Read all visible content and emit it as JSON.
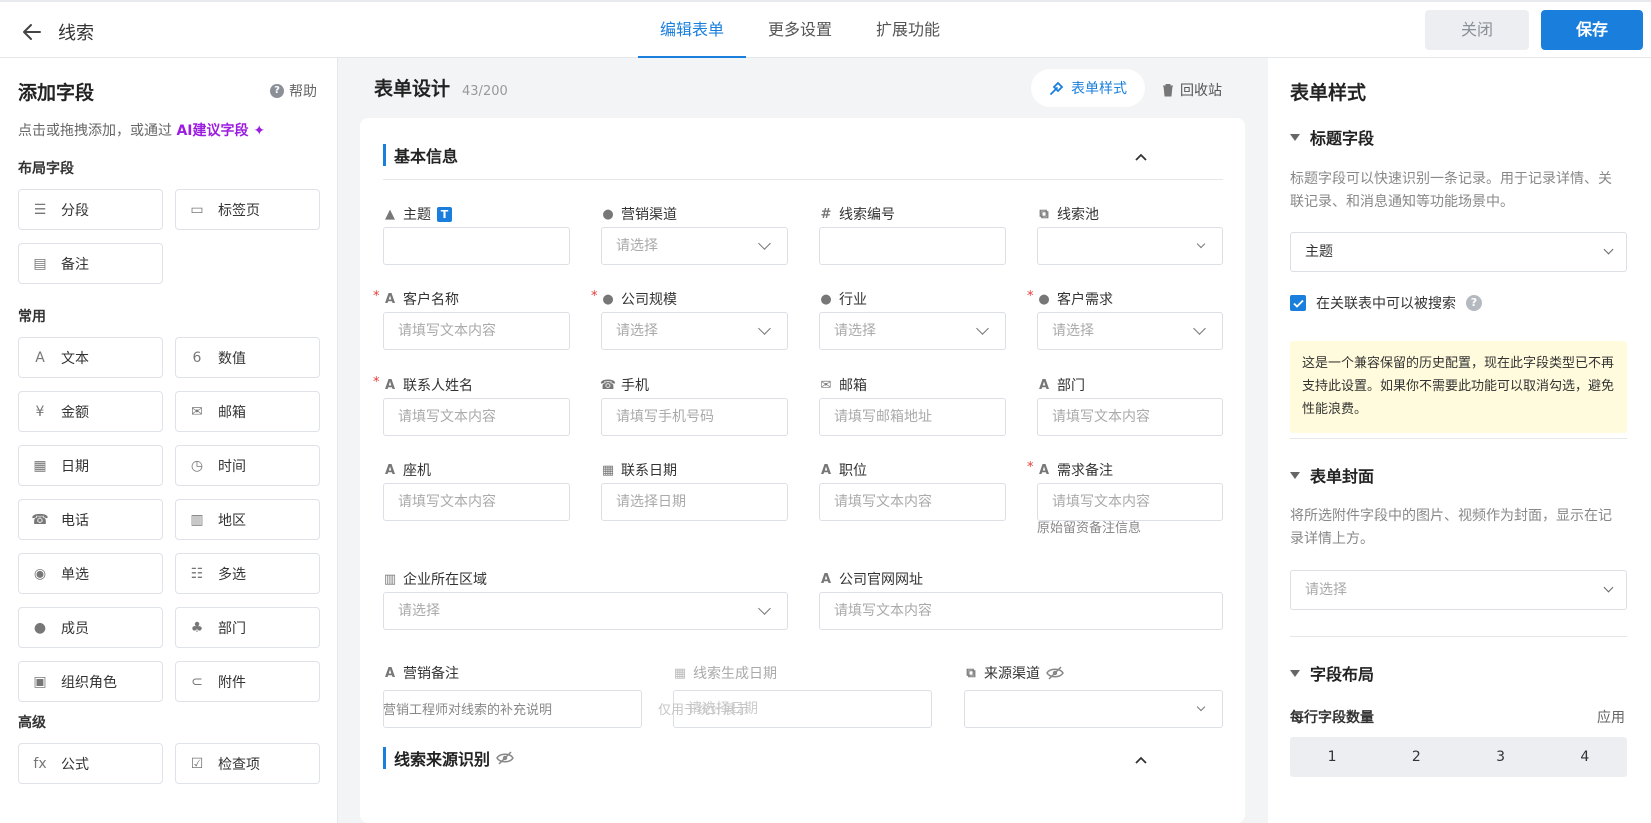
{
  "header": {
    "title": "线索",
    "tabs": [
      "编辑表单",
      "更多设置",
      "扩展功能"
    ],
    "close_label": "关闭",
    "save_label": "保存"
  },
  "left": {
    "title": "添加字段",
    "help": "帮助",
    "tip_prefix": "点击或拖拽添加，或通过",
    "tip_ai": "AI建议字段",
    "groups": [
      {
        "title": "布局字段",
        "items": [
          [
            "分段",
            "section-icon"
          ],
          [
            "标签页",
            "tab-page-icon"
          ],
          [
            "备注",
            "note-icon"
          ]
        ]
      },
      {
        "title": "常用",
        "items": [
          [
            "文本",
            "text-icon"
          ],
          [
            "数值",
            "number-icon"
          ],
          [
            "金额",
            "currency-icon"
          ],
          [
            "邮箱",
            "email-icon"
          ],
          [
            "日期",
            "calendar-icon"
          ],
          [
            "时间",
            "clock-icon"
          ],
          [
            "电话",
            "phone-icon"
          ],
          [
            "地区",
            "map-icon"
          ],
          [
            "单选",
            "single-select-icon"
          ],
          [
            "多选",
            "multi-select-icon"
          ],
          [
            "成员",
            "member-icon"
          ],
          [
            "部门",
            "org-icon"
          ],
          [
            "组织角色",
            "role-icon"
          ],
          [
            "附件",
            "attachment-icon"
          ]
        ]
      },
      {
        "title": "高级",
        "items": [
          [
            "公式",
            "formula-icon"
          ],
          [
            "检查项",
            "checkbox-icon"
          ]
        ]
      }
    ]
  },
  "center": {
    "title": "表单设计",
    "count": "43/200",
    "style_btn": "表单样式",
    "bin_btn": "回收站",
    "section1": "基本信息",
    "section2": "线索来源识别",
    "fields": {
      "subject": "主题",
      "channel": "营销渠道",
      "lead_no": "线索编号",
      "pool": "线索池",
      "customer": "客户名称",
      "size": "公司规模",
      "industry": "行业",
      "demand": "客户需求",
      "contact": "联系人姓名",
      "mobile": "手机",
      "email": "邮箱",
      "dept": "部门",
      "landline": "座机",
      "contact_date": "联系日期",
      "position": "职位",
      "demand_note": "需求备注",
      "region": "企业所在区域",
      "website": "公司官网网址",
      "mkt_note": "营销备注",
      "gen_date": "线索生成日期",
      "source": "来源渠道"
    },
    "ph": {
      "select": "请选择",
      "text": "请填写文本内容",
      "mobile": "请填写手机号码",
      "email": "请填写邮箱地址",
      "date": "请选择日期"
    },
    "hints": {
      "demand_note": "原始留资备注信息",
      "mkt_note": "营销工程师对线索的补充说明",
      "gen_date": "仅用于统计展示"
    }
  },
  "right": {
    "title": "表单样式",
    "sec_title_field": "标题字段",
    "title_field_desc": "标题字段可以快速识别一条记录。用于记录详情、关联记录、和消息通知等功能场景中。",
    "title_field_value": "主题",
    "searchable_label": "在关联表中可以被搜索",
    "warning": "这是一个兼容保留的历史配置，现在此字段类型已不再支持此设置。如果你不需要此功能可以取消勾选，避免性能浪费。",
    "sec_cover": "表单封面",
    "cover_desc": "将所选附件字段中的图片、视频作为封面，显示在记录详情上方。",
    "cover_placeholder": "请选择",
    "sec_layout": "字段布局",
    "per_row_label": "每行字段数量",
    "apply": "应用",
    "per_row_options": [
      "1",
      "2",
      "3",
      "4"
    ]
  },
  "colors": {
    "accent": "#1a7fdc",
    "ai": "#9b1de0",
    "required": "#e53935",
    "warning_bg": "#fffbdc"
  }
}
